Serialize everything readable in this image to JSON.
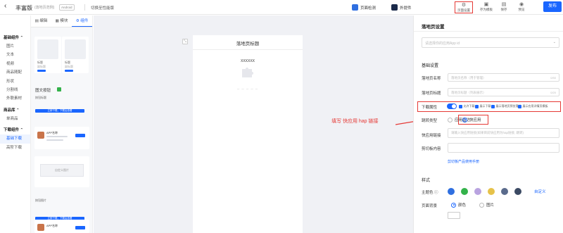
{
  "topbar": {
    "back_icon": "chevron-left",
    "app_name": "丰富版",
    "app_subtitle": "(落地页范例)",
    "os_tag": "Android",
    "switch_label": "切换至性能版",
    "tools": [
      {
        "label": "页面检测",
        "icon": "shield-check"
      },
      {
        "label": "外提件",
        "icon": "ps-app"
      }
    ],
    "icon_tools": [
      {
        "label": "页面设置",
        "icon": "settings"
      },
      {
        "label": "存为模板",
        "icon": "template"
      },
      {
        "label": "保存",
        "icon": "save"
      },
      {
        "label": "预览",
        "icon": "eye"
      }
    ],
    "publish_label": "发布"
  },
  "categories": {
    "groups": [
      {
        "title": "基础组件",
        "items": [
          "图片",
          "文本",
          "视频",
          "商品随配",
          "形状",
          "分割线",
          "外联素材"
        ]
      },
      {
        "title": "商品库",
        "items": [
          "单商品"
        ]
      },
      {
        "title": "下载组件",
        "items": [
          "基础下载",
          "高阶下载"
        ]
      }
    ],
    "active_item": "基础下载"
  },
  "panel": {
    "tabs": [
      {
        "label": "编辑",
        "icon": "edit"
      },
      {
        "label": "模块",
        "icon": "grid"
      },
      {
        "label": "组件",
        "icon": "component"
      }
    ],
    "active_tab": "组件",
    "card1_label": "标题",
    "card1_sub": "副标题",
    "section_title": "图文按钮",
    "section_sub": "按钮标题",
    "btn_text": "立即下载，下载后查看",
    "app_name": "APP名称",
    "image_label": "自定义图片",
    "lower_title": "按钮图片"
  },
  "canvas": {
    "page_title": "落地页标题",
    "placeholder_text": "XXXXXX",
    "loading_text": "一  一  一  一  一"
  },
  "annotation": {
    "text": "填写 快应用 hap 链接"
  },
  "settings": {
    "title": "落地页设置",
    "select_placeholder": "请选择你的应用App id",
    "basic_section": "基础设置",
    "page_name_label": "落地页名称",
    "page_name_placeholder": "落地页名称（用于管理）",
    "page_name_count": "0/50",
    "page_title_label": "落地页标题",
    "page_title_placeholder": "落地页标题（列表展示）",
    "page_title_count": "0/20",
    "download_label": "下载属性",
    "download_opts": [
      "允许下载",
      "展示下载",
      "展示落地页预览落地",
      "展示应用详情页模板"
    ],
    "jump_label": "跳转类型",
    "jump_opts": [
      "应用直达",
      "快应用"
    ],
    "jump_selected": "快应用",
    "quick_app_label": "快应用链接",
    "quick_app_placeholder": "请输入快应用链接(如果目前快应用为hap链接, 跳转)",
    "clipboard_label": "剪切板内容",
    "clipboard_link": "剪切板产品使用手册",
    "style_section": "样式",
    "theme_label": "主题色",
    "theme_colors": [
      "#2f6fe0",
      "#33b24a",
      "#b9a3e0",
      "#e6c24a",
      "#5a6b8c",
      "#3b4a63"
    ],
    "custom_label": "自定义",
    "bg_label": "页面背景",
    "bg_opts": [
      "颜色",
      "图片"
    ],
    "bg_selected": "颜色"
  }
}
